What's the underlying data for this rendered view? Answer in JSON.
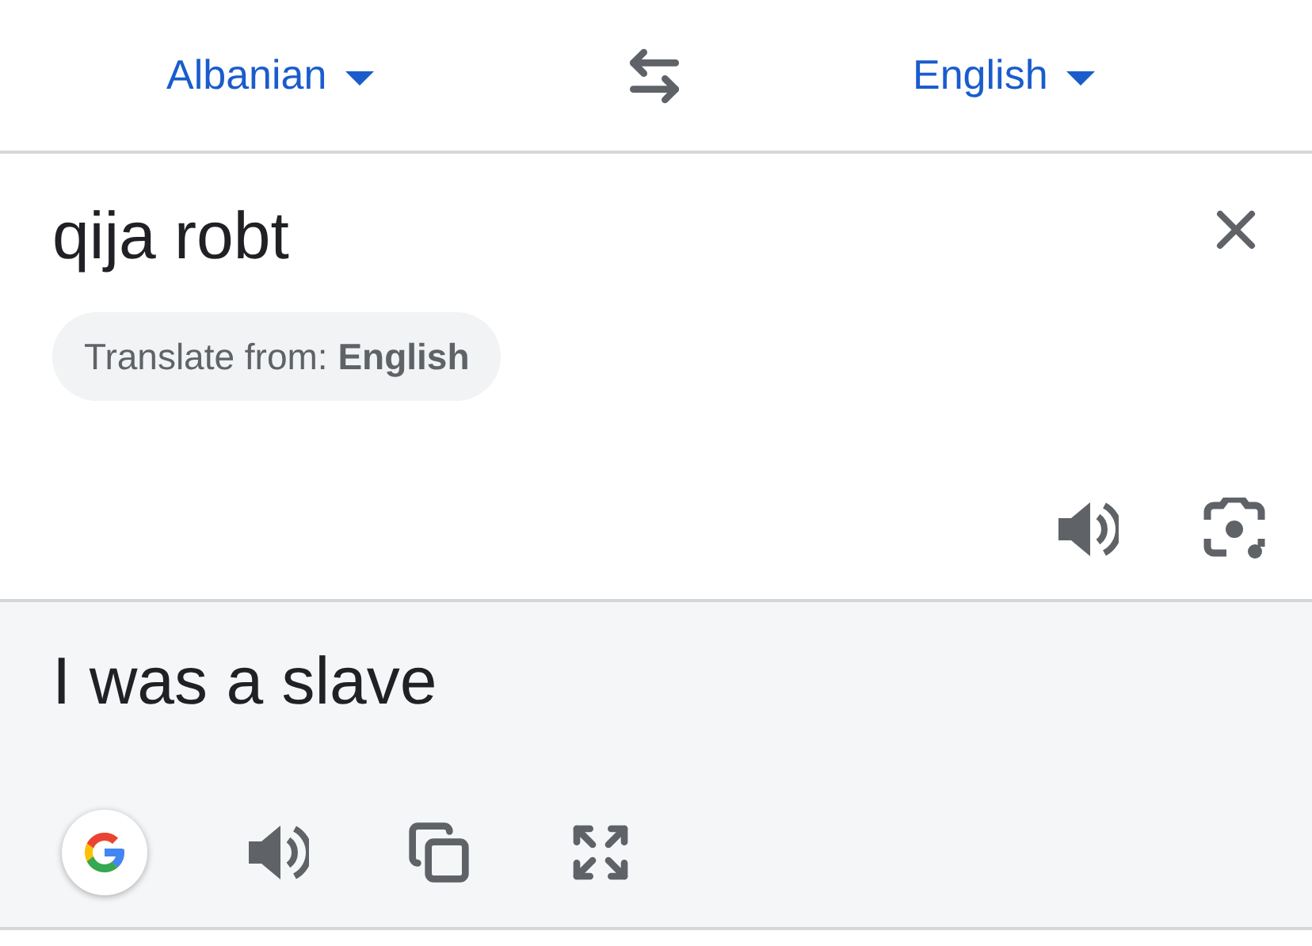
{
  "language_bar": {
    "source_language": "Albanian",
    "target_language": "English"
  },
  "input": {
    "text": "qija robt",
    "suggestion_chip": "Translate from: **English**"
  },
  "output": {
    "text": "I was a slave"
  }
}
